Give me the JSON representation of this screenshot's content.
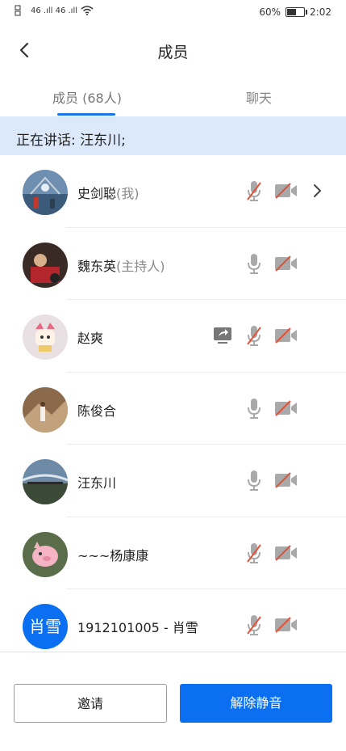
{
  "status_bar": {
    "network_left": "46 .ıll 46 .ıll",
    "battery_text": "60%",
    "battery_level": 0.6,
    "time": "2:02"
  },
  "header": {
    "title": "成员"
  },
  "tabs": [
    {
      "label": "成员 (68人)"
    },
    {
      "label": "聊天"
    }
  ],
  "speaking": {
    "text": "正在讲话: 汪东川;"
  },
  "members": [
    {
      "name": "史剑聪",
      "role": "(我)",
      "avatar": "photo",
      "mic": "muted",
      "camera": "off",
      "chevron": true
    },
    {
      "name": "魏东英",
      "role": "(主持人)",
      "avatar": "photo",
      "mic": "on",
      "camera": "off"
    },
    {
      "name": "赵爽",
      "role": "",
      "avatar": "photo",
      "mic": "muted",
      "camera": "off",
      "share": true
    },
    {
      "name": "陈俊合",
      "role": "",
      "avatar": "photo",
      "mic": "on",
      "camera": "off"
    },
    {
      "name": "汪东川",
      "role": "",
      "avatar": "photo",
      "mic": "on",
      "camera": "off"
    },
    {
      "name": "~~~杨康康",
      "role": "",
      "avatar": "photo",
      "mic": "muted",
      "camera": "off"
    },
    {
      "name": "1912101005 - 肖雪",
      "role": "",
      "avatar_text": "肖雪",
      "mic": "muted",
      "camera": "off"
    }
  ],
  "actions": {
    "invite_label": "邀请",
    "unmute_label": "解除静音"
  },
  "colors": {
    "accent": "#0a6ff0",
    "speaking_bg": "#dbe9fb",
    "muted_red": "#e0533a"
  }
}
